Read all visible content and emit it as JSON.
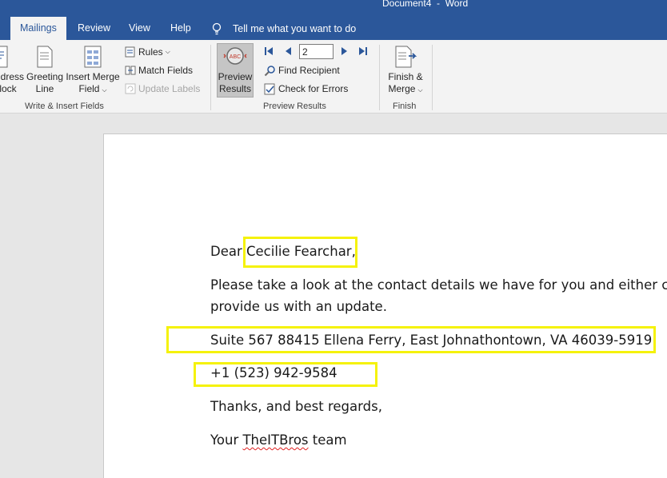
{
  "window": {
    "title": "Document4  -  Word"
  },
  "tabs": [
    {
      "label": "Mailings",
      "active": true
    },
    {
      "label": "Review",
      "active": false
    },
    {
      "label": "View",
      "active": false
    },
    {
      "label": "Help",
      "active": false
    }
  ],
  "tell_me": {
    "label": "Tell me what you want to do"
  },
  "ribbon": {
    "write_insert": {
      "group_label": "Write & Insert Fields",
      "address_block": [
        "ddress",
        "lock"
      ],
      "greeting_line": [
        "Greeting",
        "Line"
      ],
      "insert_merge_field": [
        "Insert Merge",
        "Field"
      ],
      "rules": "Rules",
      "match_fields": "Match Fields",
      "update_labels": "Update Labels"
    },
    "preview_results": {
      "group_label": "Preview Results",
      "preview_button": [
        "Preview",
        "Results"
      ],
      "record_number": "2",
      "find_recipient": "Find Recipient",
      "check_for_errors": "Check for Errors"
    },
    "finish": {
      "group_label": "Finish",
      "finish_merge": [
        "Finish &",
        "Merge"
      ]
    }
  },
  "document": {
    "salutation_prefix": "Dear ",
    "recipient_name": "Cecilie Fearchar,",
    "body_line1": "Please take a look at the contact details we have for you and either co",
    "body_line2": "provide us with an update.",
    "address": "Suite 567 88415 Ellena Ferry, East Johnathontown, VA 46039-5919",
    "phone": "+1 (523) 942-9584",
    "closing": "Thanks, and best regards,",
    "signature_prefix": "Your ",
    "signature_brand": "TheITBros",
    "signature_suffix": " team"
  },
  "colors": {
    "title_bar": "#2b579a",
    "highlight": "#f5f20a",
    "ribbon": "#f3f3f3"
  }
}
